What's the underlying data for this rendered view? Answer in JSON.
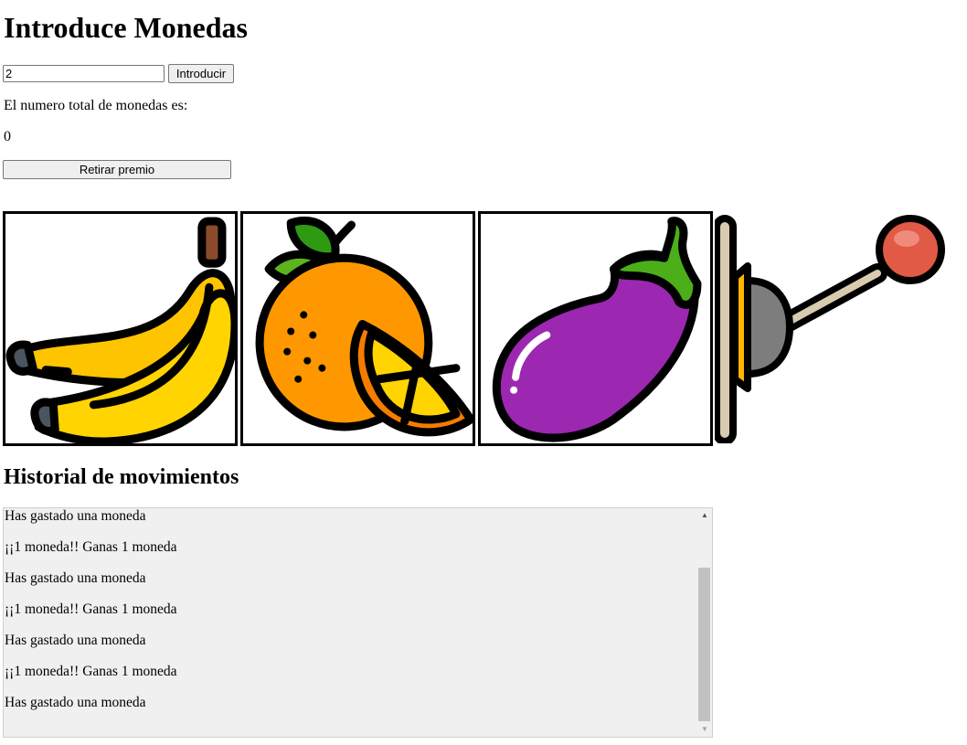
{
  "header": {
    "title": "Introduce Monedas"
  },
  "coin_form": {
    "input_value": "2",
    "submit_label": "Introducir"
  },
  "total": {
    "label": "El numero total de monedas es:",
    "value": "0"
  },
  "withdraw": {
    "label": "Retirar premio"
  },
  "reels": [
    {
      "symbol": "banana-icon"
    },
    {
      "symbol": "orange-icon"
    },
    {
      "symbol": "eggplant-icon"
    }
  ],
  "lever": {
    "icon": "slot-lever-icon"
  },
  "history": {
    "title": "Historial de movimientos",
    "items": [
      "Has gastado una moneda",
      "¡¡1 moneda!! Ganas 1 moneda",
      "Has gastado una moneda",
      "¡¡1 moneda!! Ganas 1 moneda",
      "Has gastado una moneda",
      "¡¡1 moneda!! Ganas 1 moneda",
      "Has gastado una moneda"
    ]
  },
  "colors": {
    "banana": "#FFD400",
    "orange": "#FF9800",
    "eggplant": "#9C27B0",
    "leaf": "#4CAF1A",
    "knob": "#E05A45",
    "panel": "#f0f0f0"
  }
}
